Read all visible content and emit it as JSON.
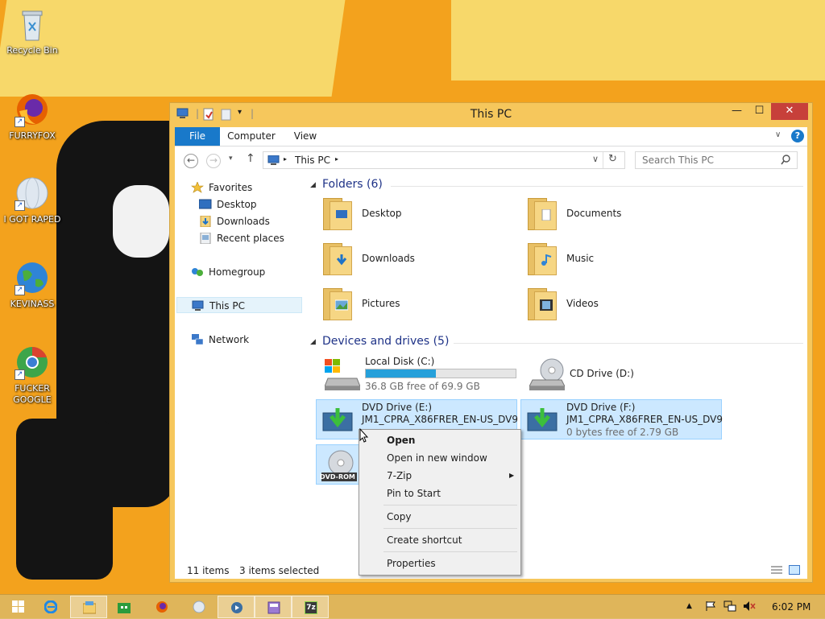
{
  "desktop_icons": [
    {
      "label": "Recycle Bin",
      "icon": "recycle-bin-icon"
    },
    {
      "label": "FURRYFOX",
      "icon": "firefox-icon"
    },
    {
      "label": "I GOT RAPED",
      "icon": "globe-icon"
    },
    {
      "label": "KEVINASS",
      "icon": "earth-icon"
    },
    {
      "label": "FUCKER GOOGLE",
      "icon": "chrome-icon"
    }
  ],
  "window": {
    "title": "This PC",
    "ribbon_tabs": [
      "File",
      "Computer",
      "View"
    ],
    "help": "?",
    "address": "This PC",
    "search_placeholder": "Search This PC"
  },
  "nav_pane": {
    "favorites": "Favorites",
    "favorite_items": [
      "Desktop",
      "Downloads",
      "Recent places"
    ],
    "homegroup": "Homegroup",
    "this_pc": "This PC",
    "network": "Network"
  },
  "folders": {
    "heading": "Folders (6)",
    "items": [
      "Desktop",
      "Documents",
      "Downloads",
      "Music",
      "Pictures",
      "Videos"
    ]
  },
  "devices": {
    "heading": "Devices and drives (5)",
    "local_disk": {
      "name": "Local Disk (C:)",
      "free": "36.8 GB free of 69.9 GB",
      "used_fraction": 0.47
    },
    "cd_drive": {
      "name": "CD Drive (D:)"
    },
    "dvd_e": {
      "name": "DVD Drive (E:)",
      "label": "JM1_CPRA_X86FRER_EN-US_DV9"
    },
    "dvd_f": {
      "name": "DVD Drive (F:)",
      "label": "JM1_CPRA_X86FRER_EN-US_DV9",
      "free": "0 bytes free of 2.79 GB"
    },
    "dvd_rom_badge": "DVD-ROM"
  },
  "status": {
    "items": "11 items",
    "selected": "3 items selected"
  },
  "context_menu": {
    "open": "Open",
    "open_new_window": "Open in new window",
    "seven_zip": "7-Zip",
    "pin_to_start": "Pin to Start",
    "copy": "Copy",
    "create_shortcut": "Create shortcut",
    "properties": "Properties"
  },
  "taskbar": {
    "clock": "6:02 PM",
    "seven_zip_label": "7z"
  },
  "colors": {
    "accent": "#1979ca",
    "selection": "#cce8ff",
    "window_frame": "#f6c75c",
    "close": "#c7403a"
  }
}
